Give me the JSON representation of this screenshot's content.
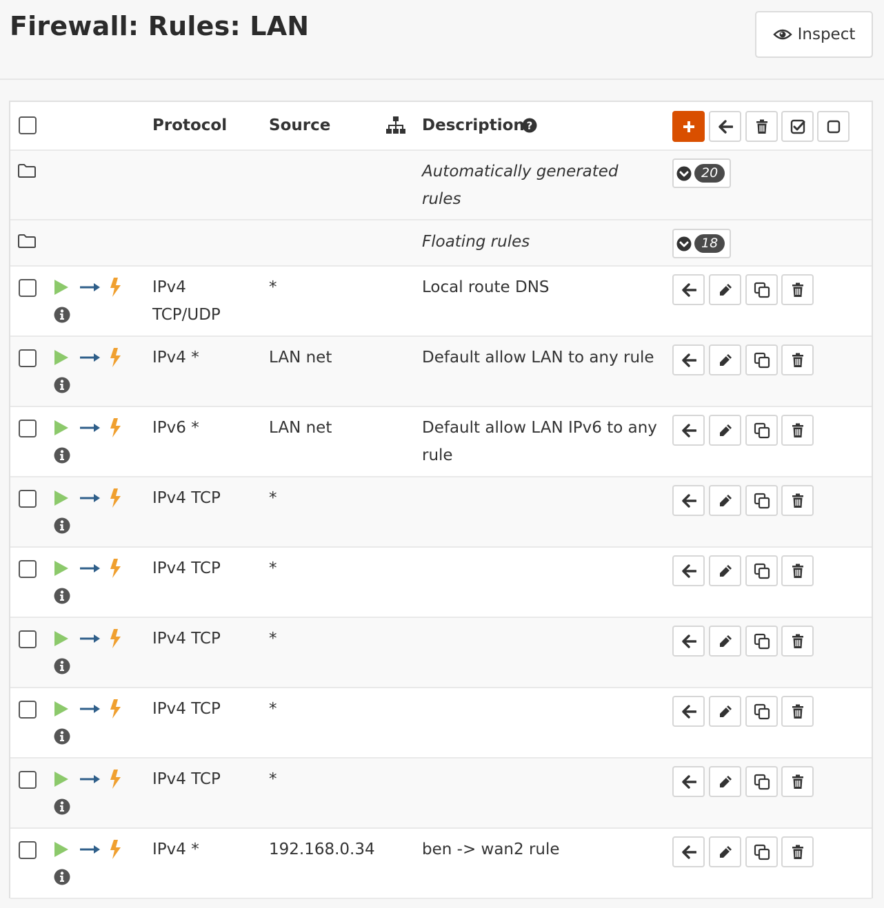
{
  "page": {
    "title": "Firewall: Rules: LAN"
  },
  "header": {
    "inspect_label": "Inspect"
  },
  "table": {
    "columns": {
      "protocol": "Protocol",
      "source": "Source",
      "description": "Description"
    },
    "groups": [
      {
        "label_line1": "Automatically generated",
        "label_line2": "rules",
        "count": "20"
      },
      {
        "label_line1": "Floating rules",
        "label_line2": "",
        "count": "18"
      }
    ],
    "rules": [
      {
        "protocol_line1": "IPv4",
        "protocol_line2": "TCP/UDP",
        "source": "*",
        "description_line1": "Local route DNS",
        "description_line2": ""
      },
      {
        "protocol_line1": "IPv4 *",
        "protocol_line2": "",
        "source": "LAN net",
        "description_line1": "Default allow LAN to any rule",
        "description_line2": ""
      },
      {
        "protocol_line1": "IPv6 *",
        "protocol_line2": "",
        "source": "LAN net",
        "description_line1": "Default allow LAN IPv6 to any",
        "description_line2": "rule"
      },
      {
        "protocol_line1": "IPv4 TCP",
        "protocol_line2": "",
        "source": "*",
        "description_line1": "",
        "description_line2": ""
      },
      {
        "protocol_line1": "IPv4 TCP",
        "protocol_line2": "",
        "source": "*",
        "description_line1": "",
        "description_line2": ""
      },
      {
        "protocol_line1": "IPv4 TCP",
        "protocol_line2": "",
        "source": "*",
        "description_line1": "",
        "description_line2": ""
      },
      {
        "protocol_line1": "IPv4 TCP",
        "protocol_line2": "",
        "source": "*",
        "description_line1": "",
        "description_line2": ""
      },
      {
        "protocol_line1": "IPv4 TCP",
        "protocol_line2": "",
        "source": "*",
        "description_line1": "",
        "description_line2": ""
      },
      {
        "protocol_line1": "IPv4 *",
        "protocol_line2": "",
        "source": "192.168.0.34",
        "description_line1": "ben -> wan2 rule",
        "description_line2": ""
      }
    ]
  },
  "colors": {
    "accent": "#d94f00",
    "pass": "#8cc96b",
    "direction": "#2f5f8a",
    "quick": "#f0a030"
  },
  "icons": {
    "inspect": "eye-icon",
    "gateway": "sitemap-icon",
    "help": "question-circle-icon",
    "add": "plus-icon",
    "move": "arrow-left-icon",
    "delete": "trash-icon",
    "enable": "check-square-icon",
    "disable": "square-icon",
    "group": "folder-icon",
    "expand": "chevron-circle-down-icon",
    "pass": "play-icon",
    "direction": "long-arrow-right-icon",
    "quick": "bolt-icon",
    "info": "info-circle-icon",
    "edit": "pencil-icon",
    "clone": "clone-icon"
  }
}
